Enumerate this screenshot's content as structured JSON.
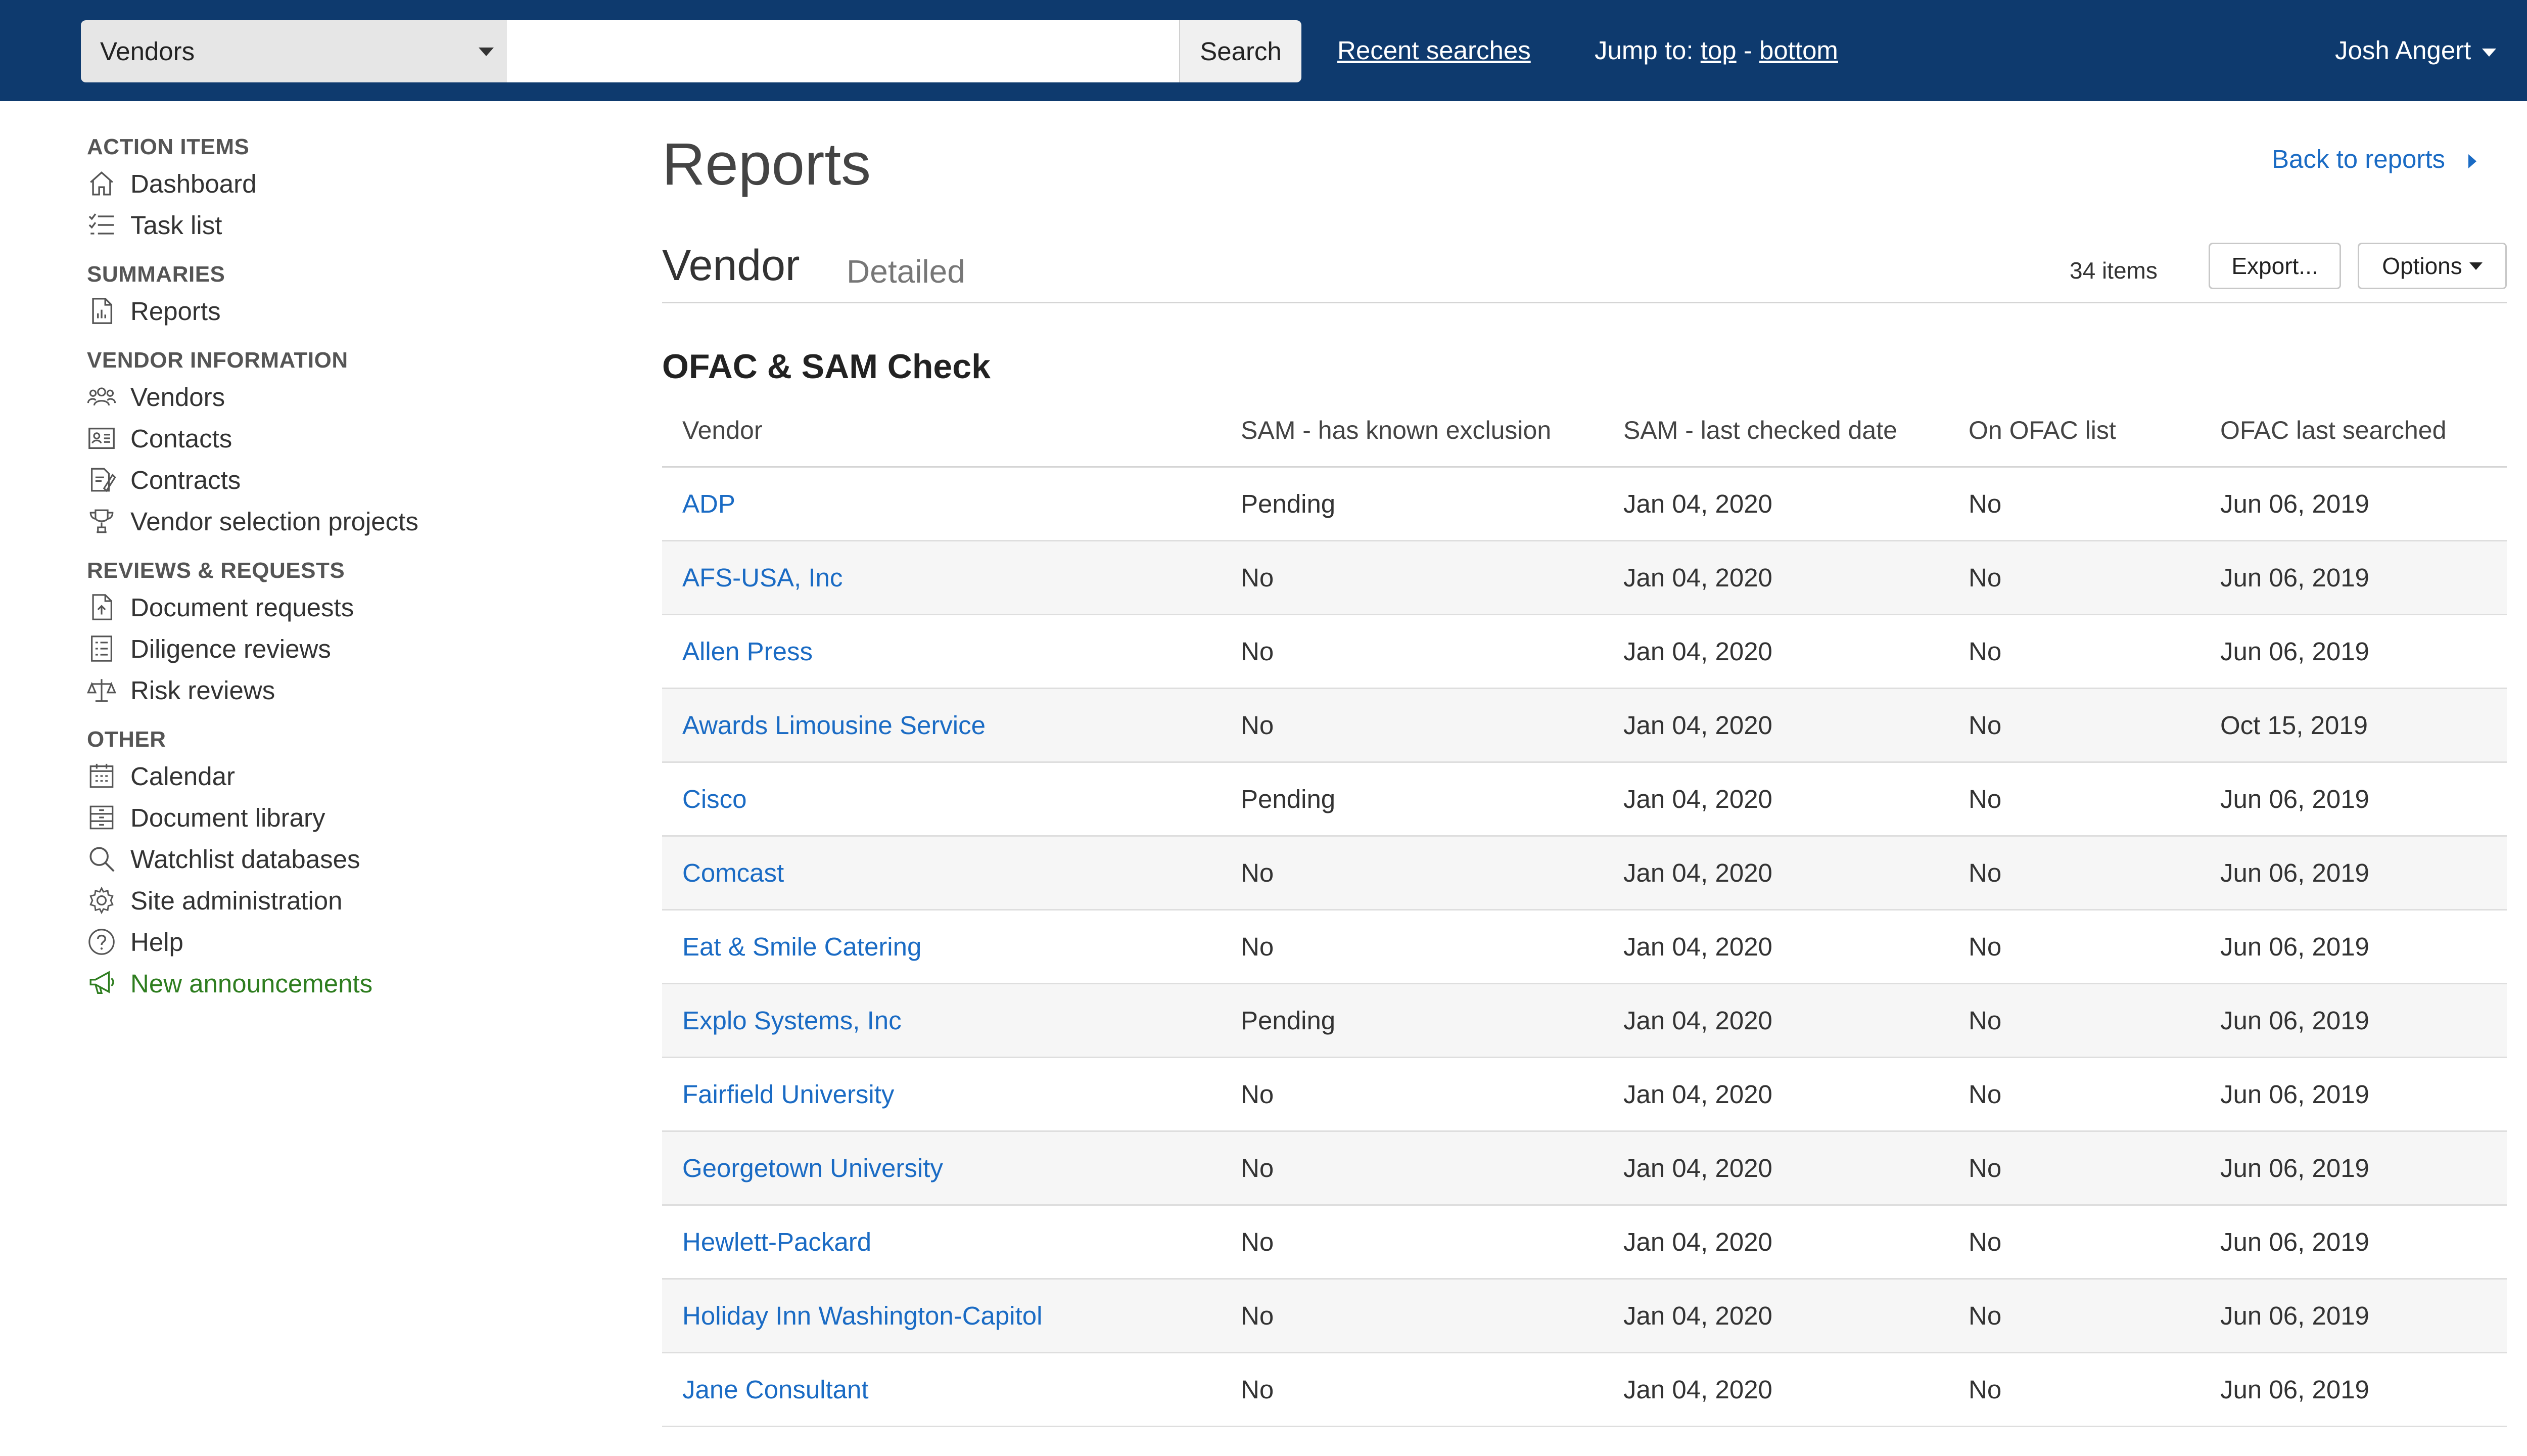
{
  "topbar": {
    "scope_value": "Vendors",
    "search_value": "",
    "search_placeholder": "",
    "search_button": "Search",
    "recent_searches": "Recent searches",
    "jump_label": "Jump to:",
    "jump_top": "top",
    "jump_sep": "-",
    "jump_bottom": "bottom",
    "user_name": "Josh Angert"
  },
  "sidebar": {
    "sections": [
      {
        "heading": "ACTION ITEMS",
        "items": [
          {
            "label": "Dashboard",
            "icon": "home-icon"
          },
          {
            "label": "Task list",
            "icon": "task-list-icon"
          }
        ]
      },
      {
        "heading": "SUMMARIES",
        "items": [
          {
            "label": "Reports",
            "icon": "report-icon"
          }
        ]
      },
      {
        "heading": "VENDOR INFORMATION",
        "items": [
          {
            "label": "Vendors",
            "icon": "users-icon"
          },
          {
            "label": "Contacts",
            "icon": "contact-card-icon"
          },
          {
            "label": "Contracts",
            "icon": "contract-icon"
          },
          {
            "label": "Vendor selection projects",
            "icon": "trophy-icon"
          }
        ]
      },
      {
        "heading": "REVIEWS & REQUESTS",
        "items": [
          {
            "label": "Document requests",
            "icon": "document-request-icon"
          },
          {
            "label": "Diligence reviews",
            "icon": "checklist-icon"
          },
          {
            "label": "Risk reviews",
            "icon": "scale-icon"
          }
        ]
      },
      {
        "heading": "OTHER",
        "items": [
          {
            "label": "Calendar",
            "icon": "calendar-icon"
          },
          {
            "label": "Document library",
            "icon": "archive-icon"
          },
          {
            "label": "Watchlist databases",
            "icon": "search-icon"
          },
          {
            "label": "Site administration",
            "icon": "gear-icon"
          },
          {
            "label": "Help",
            "icon": "help-icon"
          },
          {
            "label": "New announcements",
            "icon": "megaphone-icon",
            "color": "#2e7d1f"
          }
        ]
      }
    ]
  },
  "main": {
    "page_title": "Reports",
    "back_link": "Back to reports",
    "subtitle": "Vendor",
    "subtitle_secondary": "Detailed",
    "item_count": "34 items",
    "export_button": "Export...",
    "options_button": "Options",
    "section_title": "OFAC & SAM Check",
    "table": {
      "columns": [
        "Vendor",
        "SAM - has known exclusion",
        "SAM - last checked date",
        "On OFAC list",
        "OFAC last searched"
      ],
      "rows": [
        [
          "ADP",
          "Pending",
          "Jan 04, 2020",
          "No",
          "Jun 06, 2019"
        ],
        [
          "AFS-USA, Inc",
          "No",
          "Jan 04, 2020",
          "No",
          "Jun 06, 2019"
        ],
        [
          "Allen Press",
          "No",
          "Jan 04, 2020",
          "No",
          "Jun 06, 2019"
        ],
        [
          "Awards Limousine Service",
          "No",
          "Jan 04, 2020",
          "No",
          "Oct 15, 2019"
        ],
        [
          "Cisco",
          "Pending",
          "Jan 04, 2020",
          "No",
          "Jun 06, 2019"
        ],
        [
          "Comcast",
          "No",
          "Jan 04, 2020",
          "No",
          "Jun 06, 2019"
        ],
        [
          "Eat & Smile Catering",
          "No",
          "Jan 04, 2020",
          "No",
          "Jun 06, 2019"
        ],
        [
          "Explo Systems, Inc",
          "Pending",
          "Jan 04, 2020",
          "No",
          "Jun 06, 2019"
        ],
        [
          "Fairfield University",
          "No",
          "Jan 04, 2020",
          "No",
          "Jun 06, 2019"
        ],
        [
          "Georgetown University",
          "No",
          "Jan 04, 2020",
          "No",
          "Jun 06, 2019"
        ],
        [
          "Hewlett-Packard",
          "No",
          "Jan 04, 2020",
          "No",
          "Jun 06, 2019"
        ],
        [
          "Holiday Inn Washington-Capitol",
          "No",
          "Jan 04, 2020",
          "No",
          "Jun 06, 2019"
        ],
        [
          "Jane Consultant",
          "No",
          "Jan 04, 2020",
          "No",
          "Jun 06, 2019"
        ]
      ]
    }
  },
  "colors": {
    "topbar_bg": "#0e3a6e",
    "link": "#1a6bc4",
    "announcement": "#2e7d1f"
  }
}
